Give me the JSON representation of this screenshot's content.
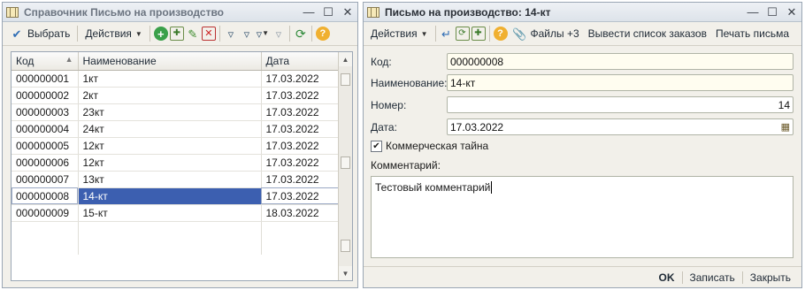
{
  "left_window": {
    "title": "Справочник Письмо на производство",
    "toolbar": {
      "select_label": "Выбрать",
      "actions_label": "Действия"
    },
    "table": {
      "columns": [
        "Код",
        "Наименование",
        "Дата"
      ],
      "rows": [
        {
          "code": "000000001",
          "name": "1кт",
          "date": "17.03.2022"
        },
        {
          "code": "000000002",
          "name": "2кт",
          "date": "17.03.2022"
        },
        {
          "code": "000000003",
          "name": "23кт",
          "date": "17.03.2022"
        },
        {
          "code": "000000004",
          "name": "24кт",
          "date": "17.03.2022"
        },
        {
          "code": "000000005",
          "name": "12кт",
          "date": "17.03.2022"
        },
        {
          "code": "000000006",
          "name": "12кт",
          "date": "17.03.2022"
        },
        {
          "code": "000000007",
          "name": "13кт",
          "date": "17.03.2022"
        },
        {
          "code": "000000008",
          "name": "14-кт",
          "date": "17.03.2022"
        },
        {
          "code": "000000009",
          "name": "15-кт",
          "date": "18.03.2022"
        }
      ],
      "selected_index": 7
    }
  },
  "right_window": {
    "title": "Письмо на производство: 14-кт",
    "toolbar": {
      "actions_label": "Действия",
      "files_label": "Файлы +3",
      "orders_label": "Вывести список заказов",
      "print_label": "Печать письма"
    },
    "form": {
      "code_label": "Код:",
      "code_value": "000000008",
      "name_label": "Наименование:",
      "name_value": "14-кт",
      "number_label": "Номер:",
      "number_value": "14",
      "date_label": "Дата:",
      "date_value": "17.03.2022",
      "secret_label": "Коммерческая тайна",
      "secret_checked": true,
      "comment_label": "Комментарий:",
      "comment_value": "Тестовый комментарий"
    },
    "bottom": {
      "ok_label": "OK",
      "save_label": "Записать",
      "close_label": "Закрыть"
    }
  },
  "colors": {
    "selection": "#3c5fb0",
    "field_bg": "#fffdf0",
    "window_bg": "#f2f0ea"
  }
}
